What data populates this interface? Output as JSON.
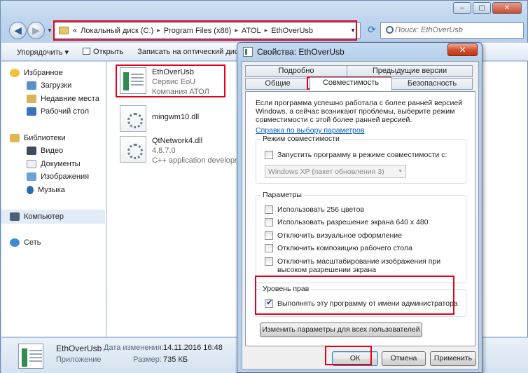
{
  "explorer": {
    "window_controls": [
      "–",
      "▢",
      "✕"
    ],
    "address": {
      "overflow": "«",
      "crumbs": [
        "Локальный диск (C:)",
        "Program Files (x86)",
        "ATOL",
        "EthOverUsb"
      ],
      "separator": "▸"
    },
    "search_placeholder": "Поиск: EthOverUsb",
    "toolbar": {
      "organize": "Упорядочить ▾",
      "open": "Открыть",
      "burn": "Записать на оптический диск"
    },
    "sidebar": {
      "favorites": "Избранное",
      "downloads": "Загрузки",
      "recent": "Недавние места",
      "desktop": "Рабочий стол",
      "libraries": "Библиотеки",
      "video": "Видео",
      "documents": "Документы",
      "images": "Изображения",
      "music": "Музыка",
      "computer": "Компьютер",
      "network": "Сеть"
    },
    "files": [
      {
        "name": "EthOverUsb",
        "line2": "Сервис EoU",
        "line3": "Компания АТОЛ"
      },
      {
        "name": "mingwm10.dll",
        "line2": "",
        "line3": ""
      },
      {
        "name": "QtNetwork4.dll",
        "line2": "4.8.7.0",
        "line3": "C++ application development framework"
      }
    ],
    "status": {
      "name": "EthOverUsb",
      "type": "Приложение",
      "modified_label": "Дата изменения:",
      "modified_value": "14.11.2016 16:48",
      "size_label": "Размер:",
      "size_value": "735 КБ"
    }
  },
  "dialog": {
    "title": "Свойства: EthOverUsb",
    "close": "✕",
    "tabs": {
      "details": "Подробно",
      "previous": "Предыдущие версии",
      "general": "Общие",
      "compat": "Совместимость",
      "security": "Безопасность"
    },
    "intro": "Если программа успешно работала с более ранней версией Windows, а сейчас возникают проблемы, выберите режим совместимости с этой более ранней версией.",
    "help_link": "Справка по выбору параметров",
    "compat_group": {
      "title": "Режим совместимости",
      "checkbox": "Запустить программу в режиме совместимости с:",
      "combo_value": "Windows XP (пакет обновления 3)"
    },
    "params_group": {
      "title": "Параметры",
      "opt1": "Использовать 256 цветов",
      "opt2": "Использовать разрешение экрана 640 x 480",
      "opt3": "Отключить визуальное оформление",
      "opt4": "Отключить композицию рабочего стола",
      "opt5a": "Отключить масштабирование изображения при",
      "opt5b": "высоком разрешении экрана"
    },
    "privilege_group": {
      "title": "Уровень прав",
      "checkbox": "Выполнять эту программу от имени администратора",
      "checked": true
    },
    "all_users_button": "Изменить параметры для всех пользователей",
    "ok": "ОК",
    "cancel": "Отмена",
    "apply": "Применить"
  },
  "colors": {
    "highlight": "#e3001b",
    "link": "#0b5fc0"
  }
}
